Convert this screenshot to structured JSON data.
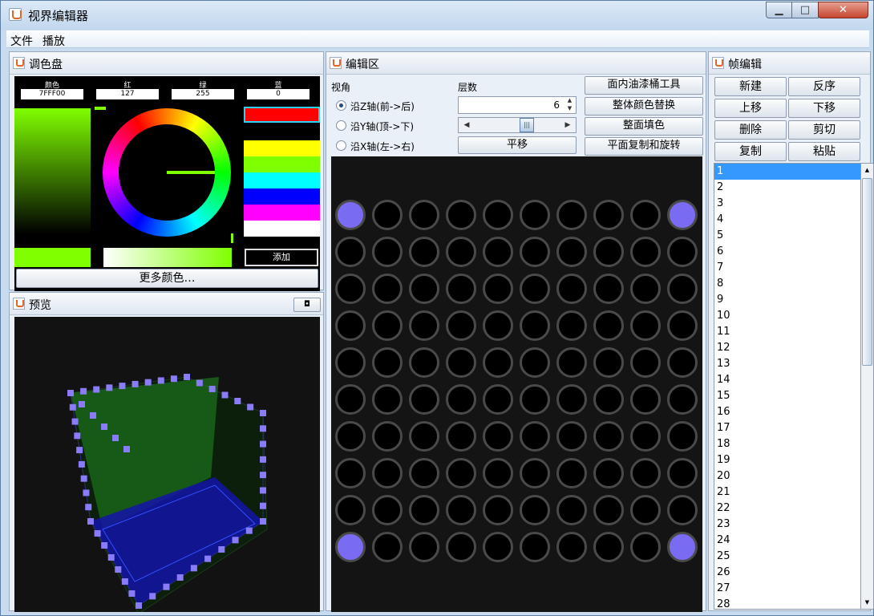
{
  "window": {
    "title": "视界编辑器",
    "min": "▁",
    "max": "□",
    "close": "✕"
  },
  "menu": [
    "文件",
    "播放"
  ],
  "palette": {
    "title": "调色盘",
    "labels": [
      "颜色",
      "红",
      "绿",
      "蓝"
    ],
    "values": [
      "7FFF00",
      "127",
      "255",
      "0"
    ],
    "swatches": [
      "#ff0000",
      "#000000",
      "#ffff00",
      "#7fff00",
      "#00ffff",
      "#0000ff",
      "#ff00ff",
      "#ffffff"
    ],
    "add_label": "添加",
    "more_label": "更多颜色…"
  },
  "preview": {
    "title": "预览",
    "restore_icon": "restore-icon"
  },
  "editor": {
    "title": "编辑区",
    "view_label": "视角",
    "layer_label": "层数",
    "layer_value": "6",
    "views": [
      "沿Z轴(前->后)",
      "沿Y轴(顶->下)",
      "沿X轴(左->右)"
    ],
    "selected_view": 0,
    "pan_label": "平移",
    "tools": [
      "面内油漆桶工具",
      "整体颜色替换",
      "整面填色",
      "平面复制和旋转"
    ],
    "lit_color": "#7a6cf2"
  },
  "frames": {
    "title": "帧编辑",
    "buttons": [
      "新建",
      "反序",
      "上移",
      "下移",
      "删除",
      "剪切",
      "复制",
      "粘贴"
    ],
    "items": [
      "1",
      "2",
      "3",
      "4",
      "5",
      "6",
      "7",
      "8",
      "9",
      "10",
      "11",
      "12",
      "13",
      "14",
      "15",
      "16",
      "17",
      "18",
      "19",
      "20",
      "21",
      "22",
      "23",
      "24",
      "25",
      "26",
      "27",
      "28"
    ],
    "selected": 0
  }
}
